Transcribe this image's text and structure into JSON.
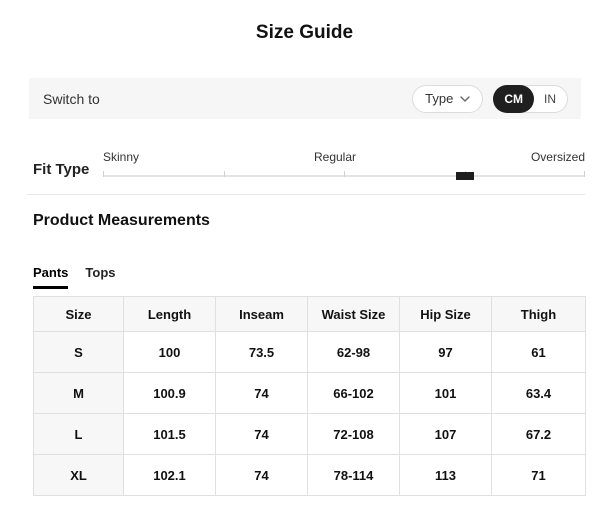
{
  "page": {
    "title": "Size Guide"
  },
  "switch_bar": {
    "label": "Switch to",
    "type_dropdown": {
      "label": "Type",
      "icon": "chevron-down-icon"
    },
    "unit_toggle": {
      "options": [
        {
          "label": "CM",
          "selected": true
        },
        {
          "label": "IN",
          "selected": false
        }
      ]
    }
  },
  "fit_type": {
    "label": "Fit Type",
    "scale_labels": [
      "Skinny",
      "Regular",
      "Oversized"
    ],
    "indicator_percent": 75
  },
  "measurements": {
    "heading": "Product Measurements",
    "tabs": [
      {
        "label": "Pants",
        "active": true
      },
      {
        "label": "Tops",
        "active": false
      }
    ],
    "table": {
      "headers": [
        "Size",
        "Length",
        "Inseam",
        "Waist Size",
        "Hip Size",
        "Thigh"
      ],
      "rows": [
        [
          "S",
          "100",
          "73.5",
          "62-98",
          "97",
          "61"
        ],
        [
          "M",
          "100.9",
          "74",
          "66-102",
          "101",
          "63.4"
        ],
        [
          "L",
          "101.5",
          "74",
          "72-108",
          "107",
          "67.2"
        ],
        [
          "XL",
          "102.1",
          "74",
          "78-114",
          "113",
          "71"
        ]
      ]
    }
  },
  "colors": {
    "selected_unit_bg": "#1f1f1f",
    "bar_bg": "#f6f6f6",
    "table_header_bg": "#f7f7f7",
    "table_border": "#e0e0e0",
    "indicator": "#1e1e1e"
  }
}
